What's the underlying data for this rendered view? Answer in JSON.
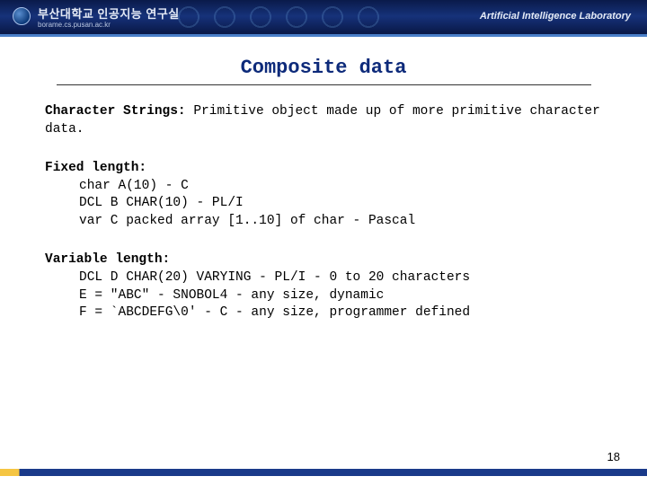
{
  "header": {
    "org_name_kr": "부산대학교 인공지능 연구실",
    "org_url": "borame.cs.pusan.ac.kr",
    "right_label": "Artificial Intelligence Laboratory"
  },
  "title": "Composite data",
  "sections": {
    "intro": {
      "label": "Character Strings:",
      "text": " Primitive object made up of more primitive character data."
    },
    "fixed": {
      "heading": "Fixed length:",
      "lines": [
        "char A(10) - C",
        "DCL B CHAR(10) - PL/I",
        "var C packed array [1..10] of char - Pascal"
      ]
    },
    "variable": {
      "heading": "Variable length:",
      "lines": [
        "DCL D CHAR(20) VARYING - PL/I - 0 to 20 characters",
        "E = \"ABC\" - SNOBOL4 - any size, dynamic",
        "F = `ABCDEFG\\0' - C - any size, programmer defined"
      ]
    }
  },
  "page_number": "18"
}
